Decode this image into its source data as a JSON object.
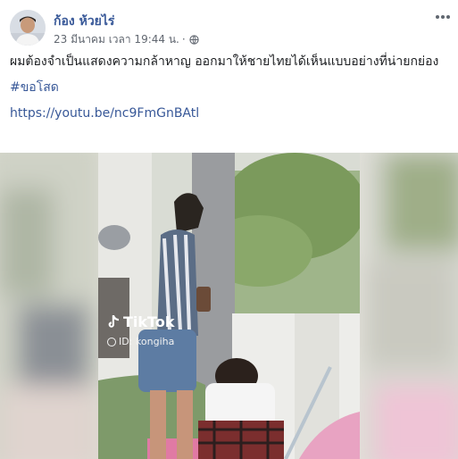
{
  "post": {
    "author": "ก้อง ห้วยไร่",
    "timestamp": "23 มีนาคม เวลา 19:44 น.",
    "separator": "·",
    "privacy_icon": "globe-icon",
    "more_icon": "more-options-icon",
    "text": "ผมต้องจำเป็นแสดงความกล้าหาญ ออกมาให้ชายไทยได้เห็นแบบอย่างที่น่ายกย่อง",
    "hashtag": "#ขอโสด",
    "link": "https://youtu.be/nc9FmGnBAtl"
  },
  "video": {
    "watermark_brand": "TikTok",
    "watermark_id": "ID: kongiha"
  },
  "colors": {
    "link": "#385898",
    "secondary_text": "#616770",
    "body_text": "#1c1e21"
  }
}
